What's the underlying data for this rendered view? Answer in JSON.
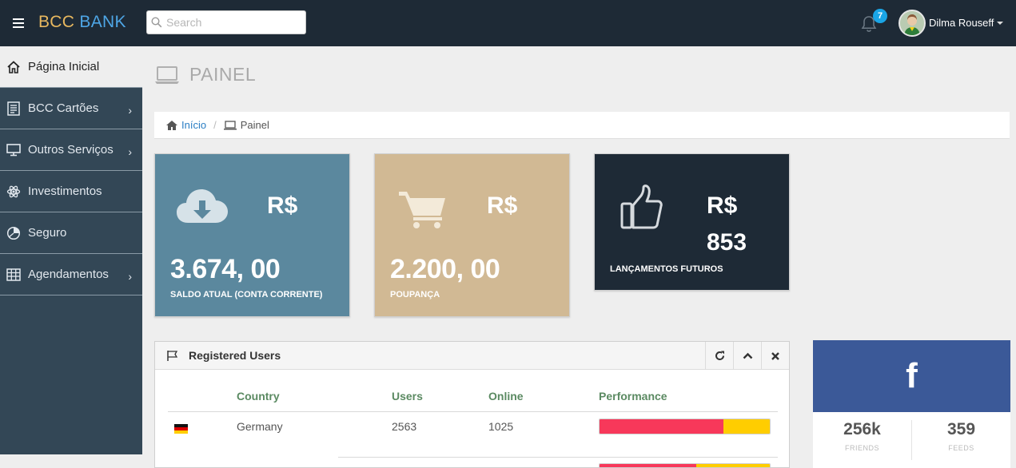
{
  "brand": {
    "part1": "BCC",
    "part2": "BANK"
  },
  "search": {
    "placeholder": "Search",
    "value": ""
  },
  "notifications": {
    "count": "7"
  },
  "user": {
    "name": "Dilma Rouseff"
  },
  "sidebar": {
    "items": [
      {
        "label": "Página Inicial",
        "icon": "home-icon",
        "active": true,
        "submenu": false
      },
      {
        "label": "BCC Cartões",
        "icon": "list-icon",
        "submenu": true
      },
      {
        "label": "Outros Serviços",
        "icon": "monitor-icon",
        "submenu": true
      },
      {
        "label": "Investimentos",
        "icon": "atom-icon",
        "submenu": false
      },
      {
        "label": "Seguro",
        "icon": "pie-chart-icon",
        "submenu": false
      },
      {
        "label": "Agendamentos",
        "icon": "table-icon",
        "submenu": true
      }
    ],
    "chevron": "›"
  },
  "page": {
    "title": "PAINEL"
  },
  "breadcrumb": {
    "home": "Início",
    "separator": "/",
    "current": "Painel"
  },
  "cards": [
    {
      "currency": "R$",
      "value": "3.674, 00",
      "label": "SALDO ATUAL (CONTA CORRENTE)",
      "color": "#5b889e",
      "icon": "cloud-download-icon"
    },
    {
      "currency": "R$",
      "value": "2.200, 00",
      "label": "POUPANÇA",
      "color": "#d1b994",
      "icon": "cart-icon"
    },
    {
      "currency": "R$",
      "value": "853",
      "label": "LANÇAMENTOS FUTUROS",
      "color": "#1e2a36",
      "icon": "thumbs-up-icon"
    }
  ],
  "users_panel": {
    "title": "Registered Users",
    "columns": [
      "Country",
      "Users",
      "Online",
      "Performance"
    ],
    "rows": [
      {
        "flag": "germany-flag-icon",
        "country": "Germany",
        "users": "2563",
        "online": "1025",
        "performance": 0.73
      },
      {
        "flag": "",
        "country": "",
        "users": "",
        "online": "",
        "performance": 0.57
      }
    ]
  },
  "facebook": {
    "icon": "f",
    "friends": "256k",
    "friends_label": "FRIENDS",
    "feeds": "359",
    "feeds_label": "FEEDS"
  },
  "colors": {
    "topbar": "#1e2a36",
    "sidebar": "#334756",
    "accent_blue": "#2a7ec4",
    "badge": "#1aa5e6",
    "bar_red": "#f7385a",
    "bar_yellow": "#ffcd00",
    "facebook": "#3b5998"
  }
}
